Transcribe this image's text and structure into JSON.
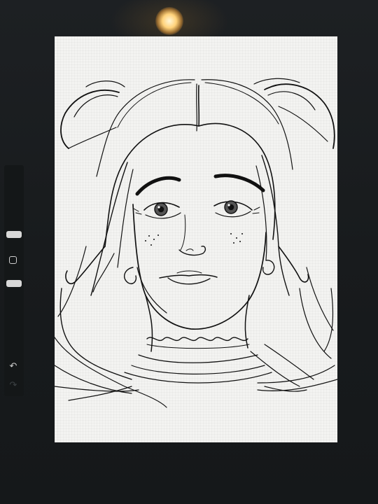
{
  "app": {
    "accent_color": "#d8d8d8",
    "canvas_color": "#f3f3f1",
    "stroke_color": "#111111"
  },
  "sidebar": {
    "size_slider": {
      "icon": "slider-handle"
    },
    "modify_button": {
      "icon": "square-outline-icon"
    },
    "opacity_slider": {
      "icon": "slider-handle"
    },
    "undo": {
      "icon": "undo-icon",
      "glyph": "↶"
    },
    "redo": {
      "icon": "redo-icon",
      "glyph": "↷"
    }
  },
  "canvas": {
    "artwork": "line-art-portrait"
  }
}
